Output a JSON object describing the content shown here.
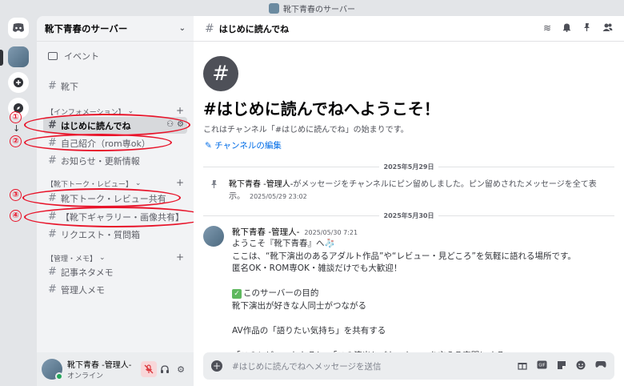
{
  "window": {
    "title": "靴下青春のサーバー"
  },
  "server": {
    "name": "靴下青春のサーバー",
    "events_label": "イベント"
  },
  "channels": {
    "top": {
      "name": "靴下"
    },
    "categories": [
      {
        "label": "【インフォメーション】"
      },
      {
        "label": "【靴下トーク・レビュー】"
      },
      {
        "label": "【管理・メモ】"
      }
    ],
    "welcome": "はじめに読んでね",
    "intro": "自己紹介（rom専ok）",
    "news": "お知らせ・更新情報",
    "talk": "靴下トーク・レビュー共有",
    "gallery": "【靴下ギャラリー・画像共有】",
    "request": "リクエスト・質問箱",
    "memo": "記事ネタメモ",
    "admin": "管理人メモ"
  },
  "annotations": [
    "①",
    "②",
    "③",
    "④"
  ],
  "user": {
    "name": "靴下青春 -管理人-",
    "status": "オンライン"
  },
  "main": {
    "channel_name": "はじめに読んでね",
    "welcome_title": "#はじめに読んでねへようこそ！",
    "welcome_sub": "これはチャンネル「#はじめに読んでね」の始まりです。",
    "edit_link": "チャンネルの編集",
    "date1": "2025年5月29日",
    "date2": "2025年5月30日",
    "pin_author": "靴下青春 -管理人-",
    "pin_text": "がメッセージをチャンネルにピン留めしました。ピン留めされたメッセージを全て表示。",
    "pin_time": "2025/05/29 23:02",
    "msg_author": "靴下青春 -管理人-",
    "msg_time": "2025/05/30 7:21",
    "msg_lines": [
      "ようこそ『靴下青春』へ🧦",
      "ここは、“靴下演出のあるアダルト作品”や“レビュー・見どころ”を気軽に語れる場所です。",
      "匿名OK・ROM専OK・雑談だけでも大歓迎！",
      "",
      "このサーバーの目的",
      "靴下演出が好きな人同士がつながる",
      "",
      "AV作品の「語りたい気持ち」を共有する",
      "",
      "「このレビューわかる！」「この演出ヤバかった…」を言える空間にする"
    ],
    "composer_placeholder": "#はじめに読んでねへメッセージを送信"
  },
  "icons": {
    "hash": "#",
    "events": "calendar-icon",
    "header": [
      "threads-icon",
      "bell-icon",
      "pin-icon",
      "members-icon"
    ],
    "composer": [
      "gift-icon",
      "gif-icon",
      "sticker-icon",
      "emoji-icon",
      "game-icon"
    ]
  },
  "colors": {
    "accent": "#006ce7",
    "annotation": "#e8142a",
    "online": "#23a55a"
  }
}
